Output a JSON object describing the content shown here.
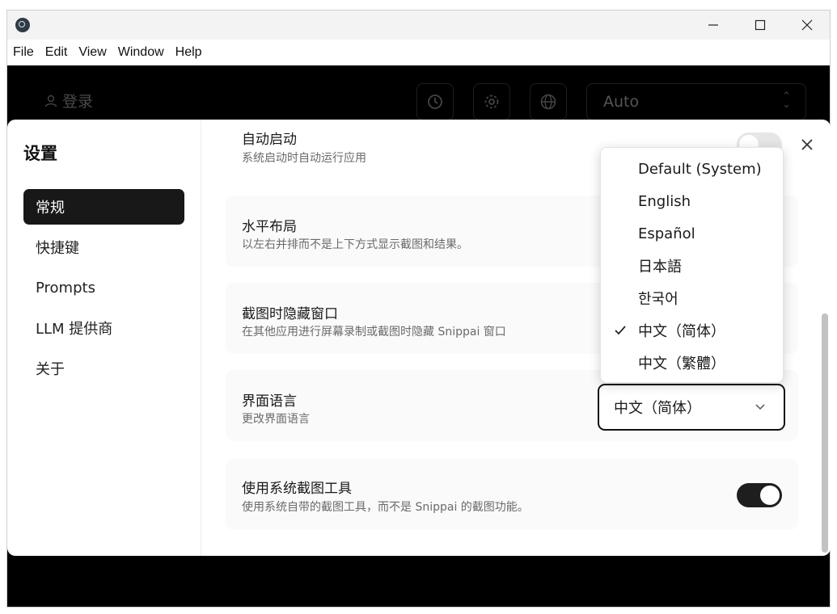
{
  "window": {
    "icon": "electron-app-icon"
  },
  "window_controls": {
    "minimize": "—",
    "maximize": "☐",
    "close": "✕"
  },
  "menu": {
    "items": [
      "File",
      "Edit",
      "View",
      "Window",
      "Help"
    ]
  },
  "toolbar": {
    "login_label": "登录",
    "history_icon": "history-icon",
    "settings_icon": "gear-icon",
    "language_icon": "globe-icon",
    "model_select_value": "Auto"
  },
  "settings": {
    "title": "设置",
    "nav": [
      "常规",
      "快捷键",
      "Prompts",
      "LLM 提供商",
      "关于"
    ],
    "active_nav": "常规",
    "rows": [
      {
        "title": "自动启动",
        "description": "系统启动时自动运行应用",
        "toggle": false
      },
      {
        "title": "水平布局",
        "description": "以左右并排而不是上下方式显示截图和结果。"
      },
      {
        "title": "截图时隐藏窗口",
        "description": "在其他应用进行屏幕录制或截图时隐藏 Snippai 窗口"
      },
      {
        "title": "界面语言",
        "description": "更改界面语言",
        "value": "中文（简体）"
      },
      {
        "title": "使用系统截图工具",
        "description": "使用系统自带的截图工具，而不是 Snippai 的截图功能。",
        "toggle": true
      }
    ]
  },
  "language_dropdown": {
    "options": [
      "Default (System)",
      "English",
      "Español",
      "日本語",
      "한국어",
      "中文（简体）",
      "中文（繁體）"
    ],
    "selected": "中文（简体）"
  }
}
